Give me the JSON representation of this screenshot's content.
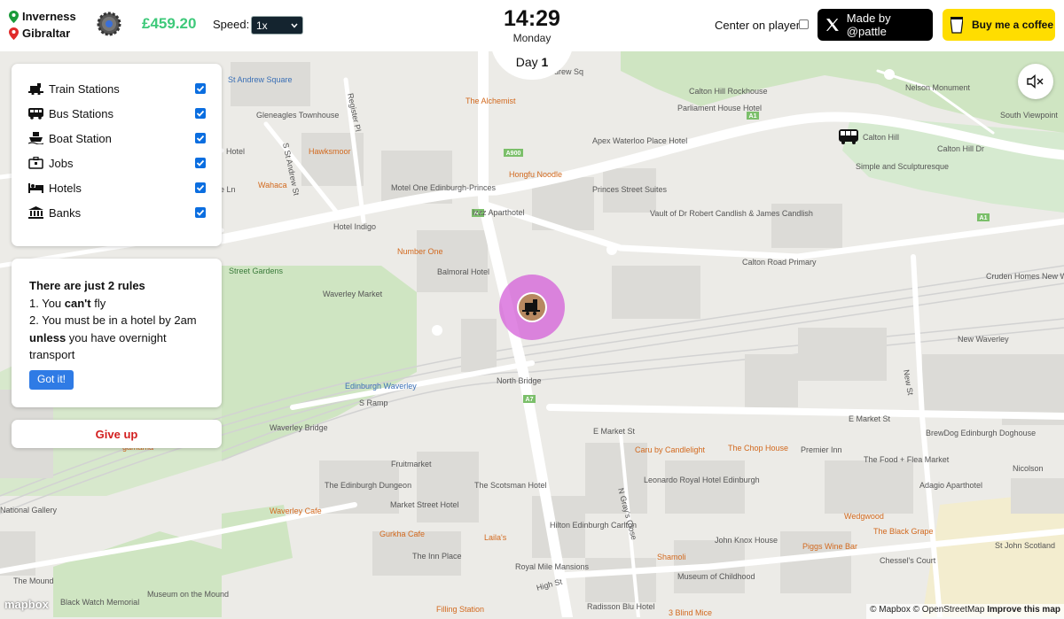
{
  "route": {
    "origin": "Inverness",
    "destination": "Gibraltar"
  },
  "money": "£459.20",
  "speed": {
    "label": "Speed:",
    "value": "1x"
  },
  "clock": {
    "time": "14:29",
    "weekday": "Monday",
    "day_label": "Day",
    "day_number": "1"
  },
  "center_on_player": {
    "label": "Center on player:",
    "checked": false
  },
  "made_by": "Made by @pattle",
  "coffee": "Buy me a coffee",
  "layers": [
    {
      "label": "Train Stations",
      "icon": "train-icon",
      "checked": true
    },
    {
      "label": "Bus Stations",
      "icon": "bus-icon",
      "checked": true
    },
    {
      "label": "Boat Station",
      "icon": "boat-icon",
      "checked": true
    },
    {
      "label": "Jobs",
      "icon": "briefcase-icon",
      "checked": true
    },
    {
      "label": "Hotels",
      "icon": "bed-icon",
      "checked": true
    },
    {
      "label": "Banks",
      "icon": "bank-icon",
      "checked": true
    }
  ],
  "rules": {
    "title": "There are just 2 rules",
    "r1_pre": "1. You ",
    "r1_bold": "can't",
    "r1_post": " fly",
    "r2_a": "2. You must be in a hotel by 2am",
    "r2_bold": "unless",
    "r2_post": " you have overnight transport",
    "button": "Got it!"
  },
  "give_up": "Give up",
  "mapbox_logo": "mapbox",
  "attribution": {
    "mapbox": "© Mapbox",
    "osm": "© OpenStreetMap",
    "improve": "Improve this map"
  },
  "colors": {
    "money": "#3ec97a",
    "give_up": "#d21e1e",
    "player_ring": "#d45fd8",
    "got_it": "#2f7be5",
    "coffee": "#ffdd00",
    "checkbox": "#0b6ee0"
  },
  "map": {
    "labels": [
      {
        "t": "Calton Hill Rockhouse",
        "c": "#555"
      },
      {
        "t": "Parliament House Hotel",
        "c": "#555"
      },
      {
        "t": "Apex Waterloo Place Hotel",
        "c": "#555"
      },
      {
        "t": "The Alchemist",
        "c": "#d2691e"
      },
      {
        "t": "Gleneagles Townhouse",
        "c": "#555"
      },
      {
        "t": "St Andrew Square",
        "c": "#3a6fb5"
      },
      {
        "t": "Hawksmoor",
        "c": "#d2691e"
      },
      {
        "t": "Wahaca",
        "c": "#d2691e"
      },
      {
        "t": "Motel One Edinburgh-Princes",
        "c": "#555"
      },
      {
        "t": "Hongfu Noodle",
        "c": "#d2691e"
      },
      {
        "t": "Princes Street Suites",
        "c": "#555"
      },
      {
        "t": "Vault of Dr Robert Candlish & James Candlish",
        "c": "#555"
      },
      {
        "t": "Hotel Indigo",
        "c": "#555"
      },
      {
        "t": "Number One",
        "c": "#d2691e"
      },
      {
        "t": "Balmoral Hotel",
        "c": "#555"
      },
      {
        "t": "Calton Road Primary",
        "c": "#555"
      },
      {
        "t": "Calton Hill",
        "c": "#555"
      },
      {
        "t": "Simple and Sculpturesque",
        "c": "#555"
      },
      {
        "t": "Calton Hill Dr",
        "c": "#555"
      },
      {
        "t": "Nelson Monument",
        "c": "#555"
      },
      {
        "t": "South Viewpoint",
        "c": "#555"
      },
      {
        "t": "Cruden Homes New Waverley Site Office",
        "c": "#555"
      },
      {
        "t": "New Waverley",
        "c": "#555"
      },
      {
        "t": "Waverley Market",
        "c": "#555"
      },
      {
        "t": "Edinburgh Waverley",
        "c": "#3a6fb5"
      },
      {
        "t": "North Bridge",
        "c": "#555"
      },
      {
        "t": "S Ramp",
        "c": "#555"
      },
      {
        "t": "Waverley Bridge",
        "c": "#555"
      },
      {
        "t": "E Market St",
        "c": "#555"
      },
      {
        "t": "E Market St",
        "c": "#555"
      },
      {
        "t": "New St",
        "c": "#555"
      },
      {
        "t": "Caru by Candlelight",
        "c": "#d2691e"
      },
      {
        "t": "The Chop House",
        "c": "#d2691e"
      },
      {
        "t": "Premier Inn",
        "c": "#555"
      },
      {
        "t": "The Food + Flea Market",
        "c": "#555"
      },
      {
        "t": "BrewDog Edinburgh Doghouse",
        "c": "#555"
      },
      {
        "t": "Adagio Aparthotel",
        "c": "#555"
      },
      {
        "t": "Nicolson",
        "c": "#555"
      },
      {
        "t": "Fruitmarket",
        "c": "#555"
      },
      {
        "t": "The Edinburgh Dungeon",
        "c": "#555"
      },
      {
        "t": "The Scotsman Hotel",
        "c": "#555"
      },
      {
        "t": "Leonardo Royal Hotel Edinburgh",
        "c": "#555"
      },
      {
        "t": "N Gray's Close",
        "c": "#555"
      },
      {
        "t": "National Gallery",
        "c": "#555"
      },
      {
        "t": "Market Street Hotel",
        "c": "#555"
      },
      {
        "t": "Hilton Edinburgh Carlton",
        "c": "#555"
      },
      {
        "t": "Waverley Cafe",
        "c": "#d2691e"
      },
      {
        "t": "Gurkha Cafe",
        "c": "#d2691e"
      },
      {
        "t": "Laila's",
        "c": "#d2691e"
      },
      {
        "t": "John Knox House",
        "c": "#555"
      },
      {
        "t": "Wedgwood",
        "c": "#d2691e"
      },
      {
        "t": "The Black Grape",
        "c": "#d2691e"
      },
      {
        "t": "St John Scotland",
        "c": "#555"
      },
      {
        "t": "Shamoli",
        "c": "#d2691e"
      },
      {
        "t": "Piggs Wine Bar",
        "c": "#d2691e"
      },
      {
        "t": "Chessel's Court",
        "c": "#555"
      },
      {
        "t": "The Inn Place",
        "c": "#555"
      },
      {
        "t": "Royal Mile Mansions",
        "c": "#555"
      },
      {
        "t": "Museum of Childhood",
        "c": "#555"
      },
      {
        "t": "The Mound",
        "c": "#555"
      },
      {
        "t": "Museum on the Mound",
        "c": "#555"
      },
      {
        "t": "High St",
        "c": "#555"
      },
      {
        "t": "Black Watch Memorial",
        "c": "#555"
      },
      {
        "t": "Filling Station",
        "c": "#d2691e"
      },
      {
        "t": "Radisson Blu Hotel",
        "c": "#555"
      },
      {
        "t": "3 Blind Mice",
        "c": "#d2691e"
      },
      {
        "t": "Register Pl",
        "c": "#555"
      },
      {
        "t": "S St Andrew St",
        "c": "#555"
      },
      {
        "t": "A900",
        "c": "#333"
      },
      {
        "t": "A1",
        "c": "#333"
      },
      {
        "t": "A7",
        "c": "#333"
      },
      {
        "t": "lzzz Aparthotel",
        "c": "#555"
      },
      {
        "t": "drew Sq",
        "c": "#555"
      },
      {
        "t": "Hotel",
        "c": "#555"
      },
      {
        "t": "Street Gardens",
        "c": "#3a7a3a"
      },
      {
        "t": "gamama",
        "c": "#d2691e"
      },
      {
        "t": "e Ln",
        "c": "#555"
      }
    ]
  }
}
